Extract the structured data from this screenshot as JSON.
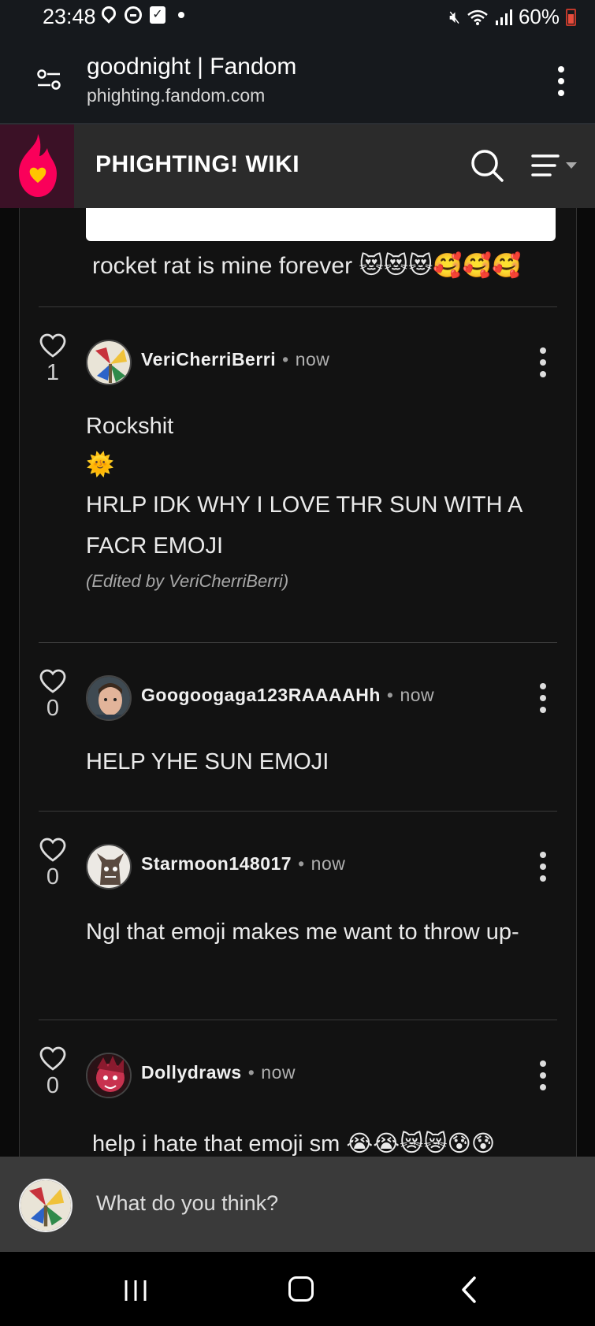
{
  "status_bar": {
    "time": "23:48",
    "battery": "60%",
    "icons": [
      "location-icon",
      "dnd-icon",
      "check-notification-icon",
      "mute-icon",
      "wifi-icon",
      "signal-icon",
      "battery-icon"
    ]
  },
  "browser": {
    "page_title": "goodnight | Fandom",
    "domain": "phighting.fandom.com"
  },
  "wiki": {
    "title": "PHIGHTING! WIKI",
    "accent": "#fa005a"
  },
  "previous_comment": {
    "text": "rocket rat is mine forever 😻😻😻🥰🥰🥰"
  },
  "comments": [
    {
      "likes": "1",
      "username": "VeriCherriBerri",
      "separator": "•",
      "time": "now",
      "lines": [
        "Rockshit",
        "🌞",
        "HRLP IDK WHY I LOVE THR SUN WITH A FACR EMOJI"
      ],
      "edited": "(Edited by VeriCherriBerri)"
    },
    {
      "likes": "0",
      "username": "Googoogaga123RAAAAHh",
      "separator": "•",
      "time": "now",
      "lines": [
        "HELP YHE SUN EMOJI"
      ]
    },
    {
      "likes": "0",
      "username": "Starmoon148017",
      "separator": "•",
      "time": "now",
      "lines": [
        "Ngl that emoji makes me want to throw up-"
      ]
    },
    {
      "likes": "0",
      "username": "Dollydraws",
      "separator": "•",
      "time": "now",
      "lines": [
        "help i hate that emoji sm 😭😭😿😿😰😰"
      ]
    }
  ],
  "composer": {
    "placeholder": "What do you think?"
  }
}
